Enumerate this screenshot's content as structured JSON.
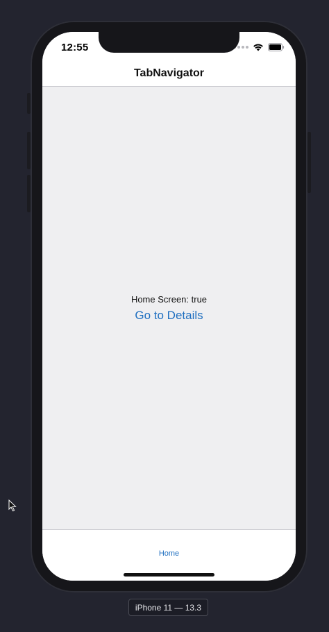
{
  "status_bar": {
    "time": "12:55"
  },
  "header": {
    "title": "TabNavigator"
  },
  "content": {
    "home_text": "Home Screen: true",
    "details_link": "Go to Details"
  },
  "tab_bar": {
    "tabs": [
      {
        "label": "Home",
        "active": true
      }
    ]
  },
  "simulator": {
    "device_label": "iPhone 11 — 13.3"
  },
  "colors": {
    "accent": "#1f6fc0",
    "desktop_bg": "#23242f",
    "content_bg": "#efeff1"
  },
  "icons": [
    "cellular-signal-icon",
    "wifi-icon",
    "battery-icon",
    "mouse-pointer-icon"
  ]
}
